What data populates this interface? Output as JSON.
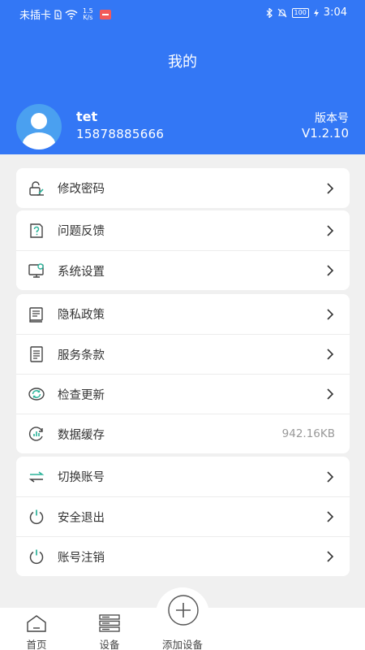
{
  "status_bar": {
    "carrier": "未插卡",
    "speed_value": "1.5",
    "speed_unit": "K/s",
    "battery": "100",
    "time": "3:04"
  },
  "header": {
    "title": "我的",
    "username": "tet",
    "phone": "15878885666",
    "version_label": "版本号",
    "version_value": "V1.2.10"
  },
  "menu": {
    "password": "修改密码",
    "feedback": "问题反馈",
    "settings": "系统设置",
    "privacy": "隐私政策",
    "terms": "服务条款",
    "update": "检查更新",
    "cache": "数据缓存",
    "cache_size": "942.16KB",
    "switch_account": "切换账号",
    "logout": "安全退出",
    "deactivate": "账号注销"
  },
  "tabbar": {
    "home": "首页",
    "devices": "设备",
    "add_device": "添加设备"
  },
  "colors": {
    "primary": "#3377f5",
    "accent_teal": "#2bb39a",
    "background": "#f0f0f0"
  },
  "icons": {
    "password": "lock-edit-icon",
    "feedback": "question-doc-icon",
    "settings": "monitor-gear-icon",
    "privacy": "book-icon",
    "terms": "document-list-icon",
    "update": "refresh-icon",
    "cache": "chart-refresh-icon",
    "switch_account": "swap-arrows-icon",
    "logout": "power-icon",
    "deactivate": "power-icon"
  }
}
